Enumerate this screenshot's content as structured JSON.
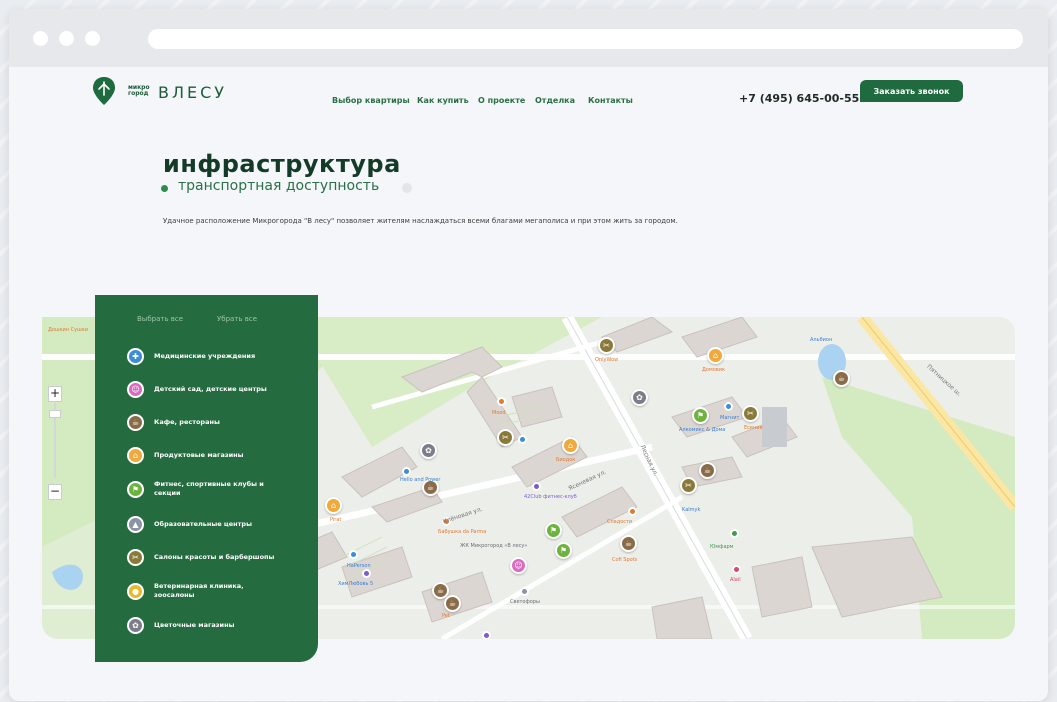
{
  "header": {
    "logo_small": "микро город",
    "logo_word": "ВЛЕСУ",
    "nav": [
      "Выбор квартиры",
      "Как купить",
      "О проекте",
      "Отделка",
      "Контакты"
    ],
    "phone": "+7 (495) 645-00-55",
    "cta": "Заказать звонок"
  },
  "page": {
    "title": "инфраструктура",
    "subtitle": "транспортная доступность",
    "description": "Удачное расположение Микрогорода \"В лесу\" позволяет жителям наслаждаться всеми благами мегаполиса и при этом жить за городом."
  },
  "panel": {
    "select_all": "Выбрать все",
    "clear_all": "Убрать все",
    "categories": [
      {
        "label": "Медицинские учреждения",
        "color": "#3a8ed8",
        "icon": "medical-cross-icon"
      },
      {
        "label": "Детский сад, детские центры",
        "color": "#d96cc1",
        "icon": "kids-icon"
      },
      {
        "label": "Кафе, рестораны",
        "color": "#8a6b47",
        "icon": "cup-icon"
      },
      {
        "label": "Продуктовые магазины",
        "color": "#f0a93a",
        "icon": "basket-icon"
      },
      {
        "label": "Фитнес, спортивные клубы и секции",
        "color": "#6fb33f",
        "icon": "fitness-icon"
      },
      {
        "label": "Образовательные центры",
        "color": "#8b93a4",
        "icon": "graduation-cap-icon"
      },
      {
        "label": "Салоны красоты и барбершопы",
        "color": "#8a7a3a",
        "icon": "scissors-icon"
      },
      {
        "label": "Ветеринарная клиника, зоосалоны",
        "color": "#e8b92b",
        "icon": "paw-icon"
      },
      {
        "label": "Цветочные магазины",
        "color": "#7b7d8a",
        "icon": "flower-icon"
      }
    ]
  },
  "map": {
    "zoom_in": "+",
    "zoom_out": "−",
    "street_labels": [
      "Пятницкое ш.",
      "Лесная ул.",
      "Клёновая ул.",
      "Ясеневая ул."
    ],
    "place_labels": [
      "Дошкин Сушки",
      "OnlyWow",
      "Домовик",
      "Альбион",
      "Mood",
      "Магнит",
      "Есения",
      "Биодок",
      "Алкомикс & Дома",
      "Hello and Power",
      "42Club фитнес-клуб",
      "Ветеринар",
      "Бабушка da Parma",
      "Nails",
      "Сладости",
      "Kalmyk",
      "ЖК Микрогород «В лесу»",
      "Cofi Spots",
      "Юмфарм",
      "Аlaii",
      "HaPerson",
      "ХимЛюбовь 5",
      "Pirat",
      "Светофоры",
      "Pet"
    ],
    "poi_colors": {
      "cafe": "#8a6b47",
      "grocery": "#f0a93a",
      "beauty": "#8a7a3a",
      "flower": "#7b7d8a",
      "fitness": "#6fb33f",
      "kids": "#d96cc1",
      "medical": "#3a8ed8"
    }
  },
  "colors": {
    "brand_green": "#1f6b3f",
    "panel_green": "#246b40",
    "map_green": "#cfe8b8",
    "building": "#d9d3d0"
  }
}
